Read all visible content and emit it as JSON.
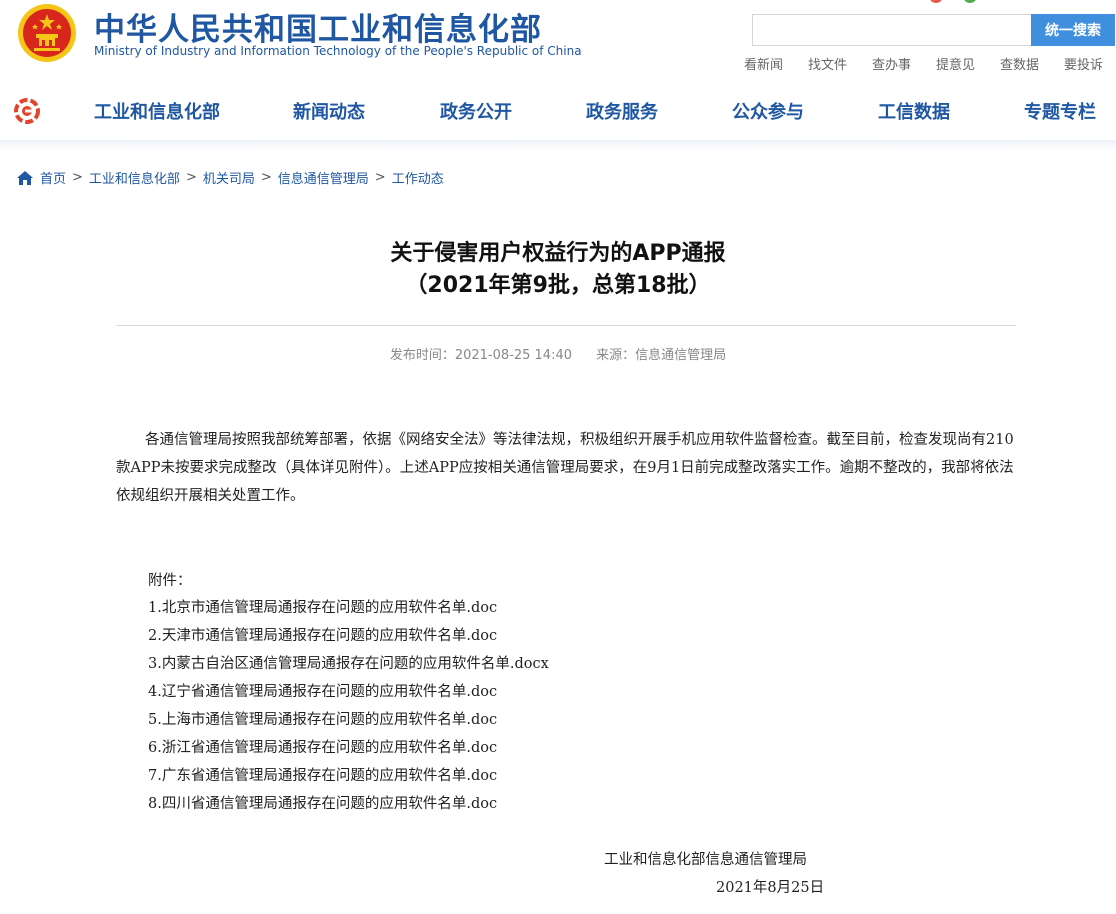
{
  "header": {
    "title_cn": "中华人民共和国工业和信息化部",
    "title_en": "Ministry of Industry and Information Technology of the People's Republic of China",
    "search_placeholder": "",
    "search_button": "统一搜索",
    "quick_links": [
      "看新闻",
      "找文件",
      "查办事",
      "提意见",
      "查数据",
      "要投诉"
    ]
  },
  "nav": {
    "items": [
      "工业和信息化部",
      "新闻动态",
      "政务公开",
      "政务服务",
      "公众参与",
      "工信数据",
      "专题专栏"
    ]
  },
  "breadcrumb": [
    "首页",
    "工业和信息化部",
    "机关司局",
    "信息通信管理局",
    "工作动态"
  ],
  "breadcrumb_sep": ">",
  "article": {
    "title_line1": "关于侵害用户权益行为的APP通报",
    "title_line2": "（2021年第9批，总第18批）",
    "publish_time": "发布时间：2021-08-25 14:40",
    "source": "来源：信息通信管理局",
    "paragraph": "各通信管理局按照我部统筹部署，依据《网络安全法》等法律法规，积极组织开展手机应用软件监督检查。截至目前，检查发现尚有210款APP未按要求完成整改（具体详见附件）。上述APP应按相关通信管理局要求，在9月1日前完成整改落实工作。逾期不整改的，我部将依法依规组织开展相关处置工作。",
    "attachments_label": "附件：",
    "attachments": [
      "1.北京市通信管理局通报存在问题的应用软件名单.doc",
      "2.天津市通信管理局通报存在问题的应用软件名单.doc",
      "3.内蒙古自治区通信管理局通报存在问题的应用软件名单.docx",
      "4.辽宁省通信管理局通报存在问题的应用软件名单.doc",
      "5.上海市通信管理局通报存在问题的应用软件名单.doc",
      "6.浙江省通信管理局通报存在问题的应用软件名单.doc",
      "7.广东省通信管理局通报存在问题的应用软件名单.doc",
      "8.四川省通信管理局通报存在问题的应用软件名单.doc"
    ],
    "signature_org": "工业和信息化部信息通信管理局",
    "signature_date": "2021年8月25日"
  },
  "colors": {
    "brand_blue": "#1f57a3",
    "search_button": "#3f8fde",
    "emblem_red": "#d9261c",
    "emblem_gold": "#f5c518"
  },
  "icons": {
    "emblem": "national-emblem-icon",
    "nav_logo": "miit-logo-icon",
    "home": "home-icon"
  }
}
